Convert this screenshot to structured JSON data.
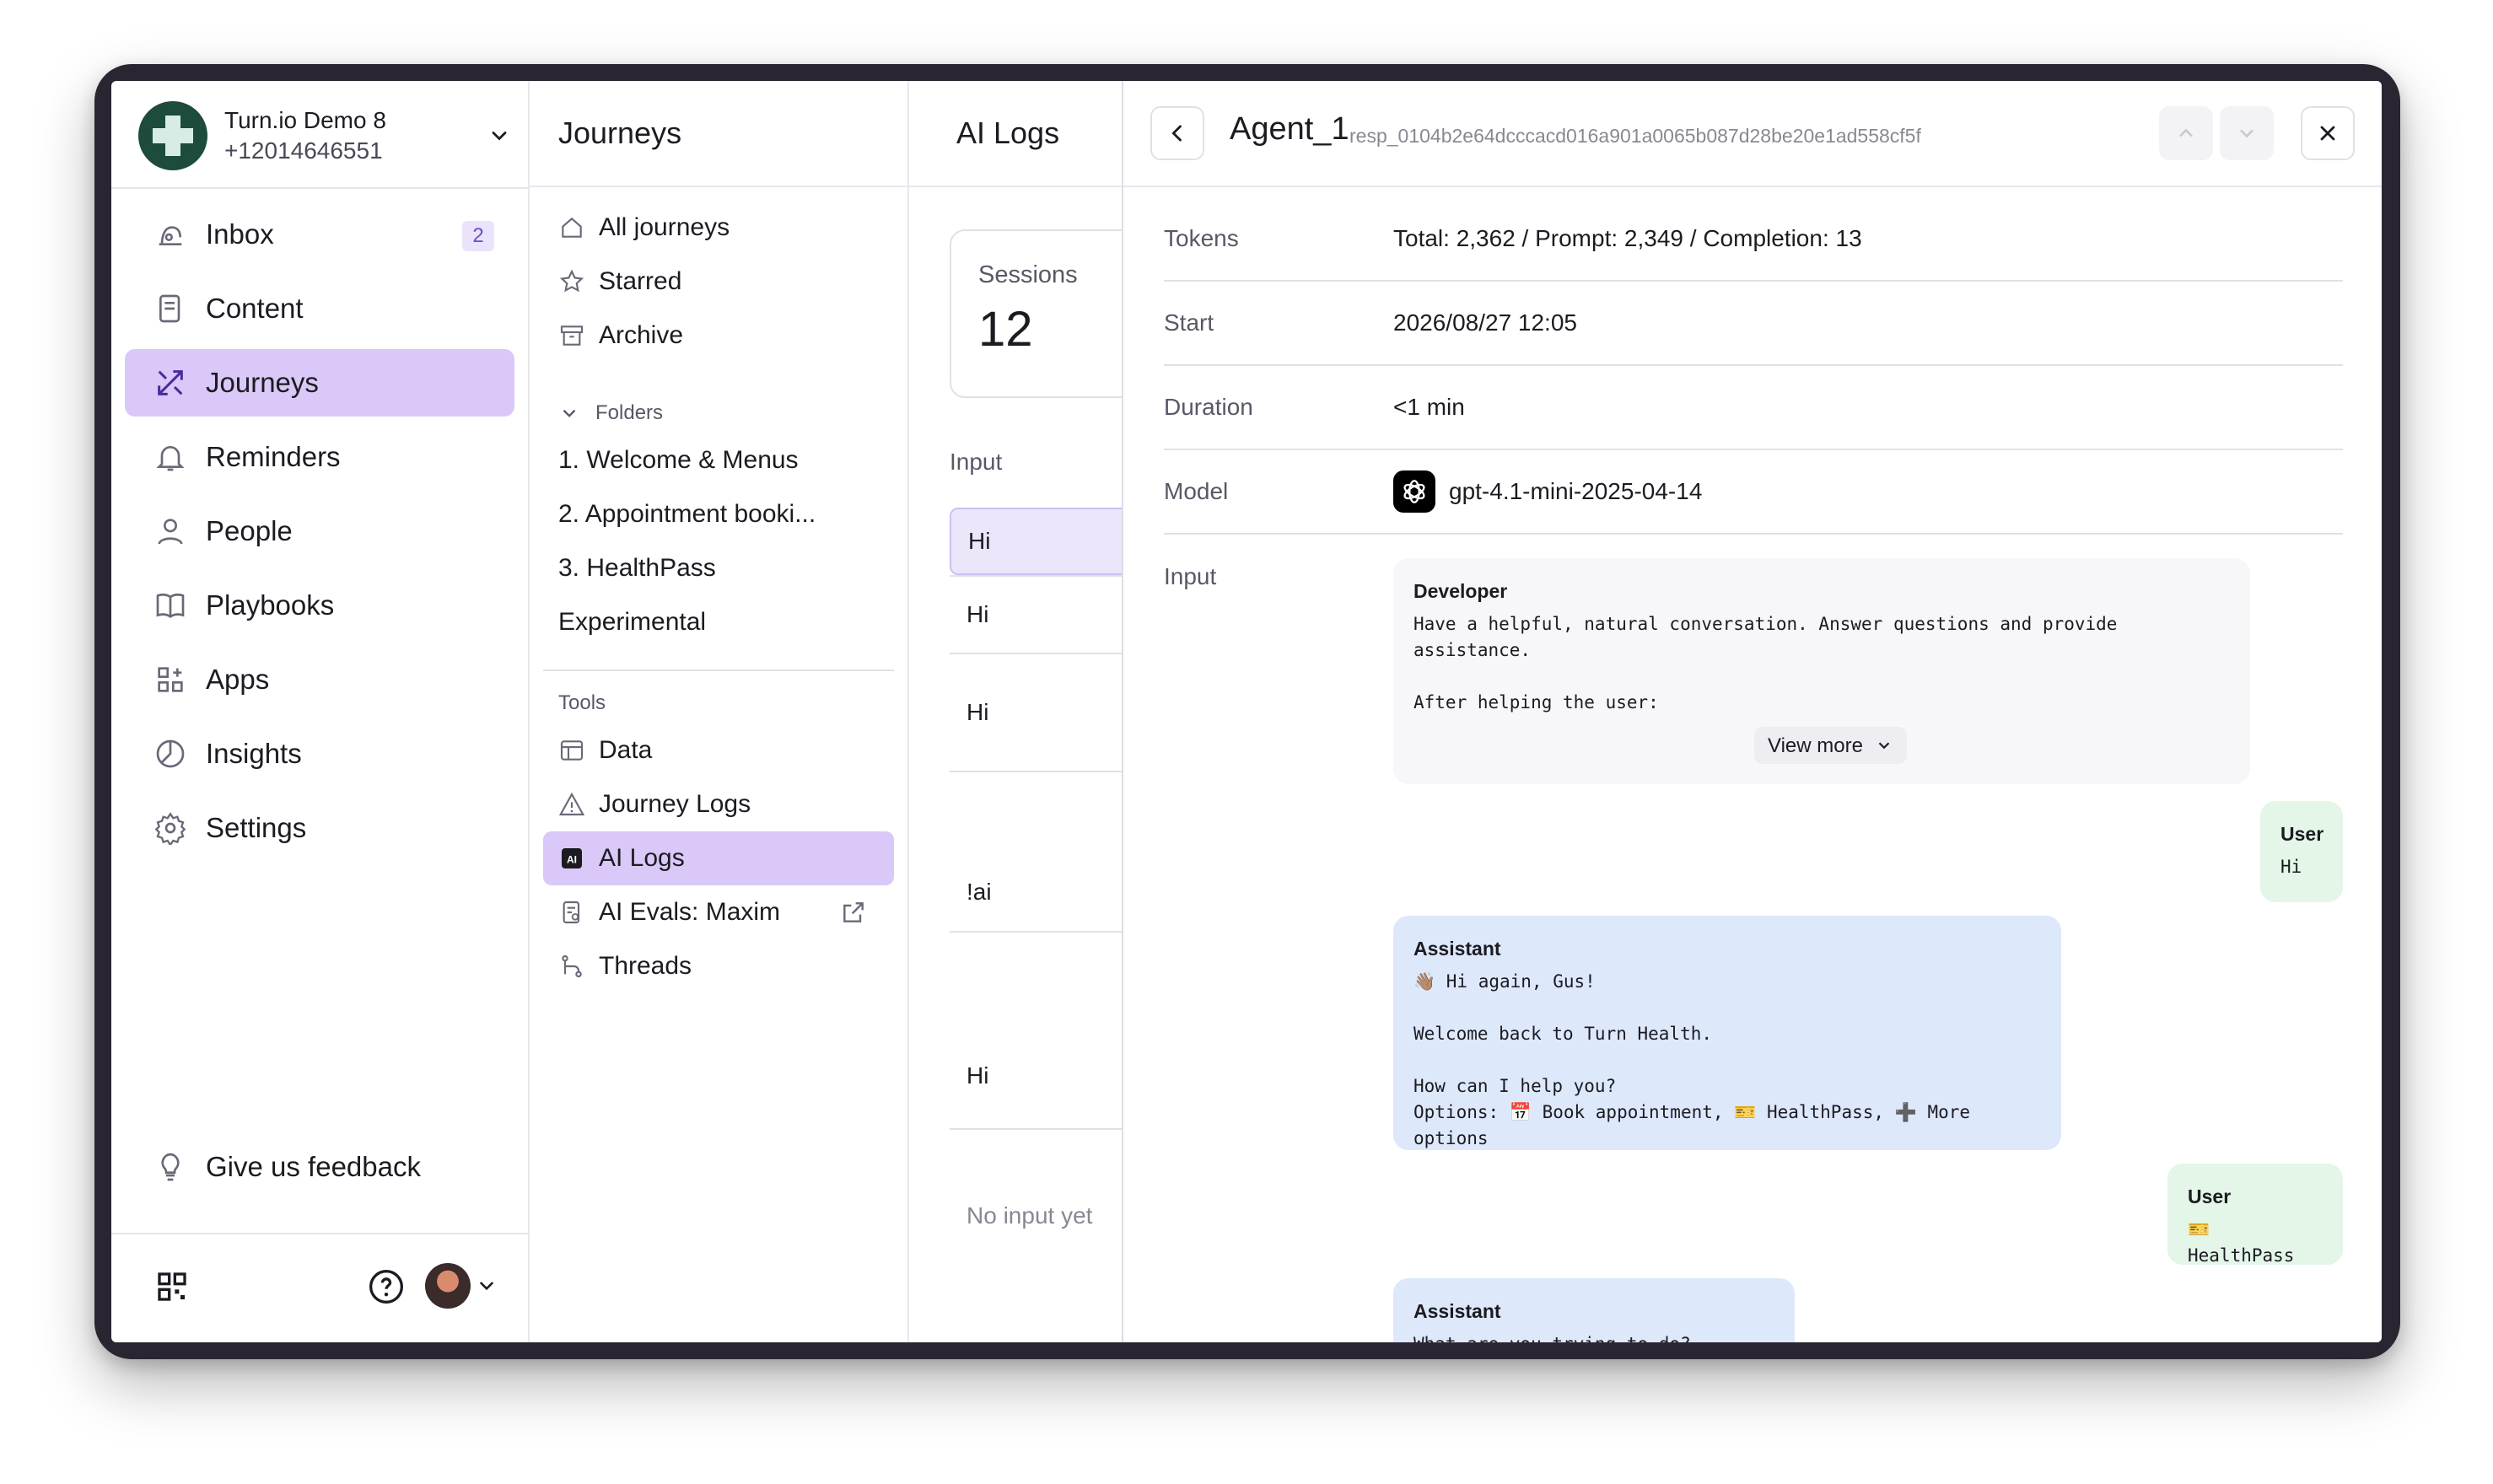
{
  "org": {
    "name": "Turn.io Demo 8",
    "phone": "+12014646551"
  },
  "sidebar": {
    "items": [
      {
        "label": "Inbox",
        "icon": "inbox-icon",
        "badge": "2"
      },
      {
        "label": "Content",
        "icon": "content-icon"
      },
      {
        "label": "Journeys",
        "icon": "journeys-icon",
        "active": true
      },
      {
        "label": "Reminders",
        "icon": "bell-icon"
      },
      {
        "label": "People",
        "icon": "person-icon"
      },
      {
        "label": "Playbooks",
        "icon": "book-icon"
      },
      {
        "label": "Apps",
        "icon": "apps-icon"
      },
      {
        "label": "Insights",
        "icon": "insights-icon"
      },
      {
        "label": "Settings",
        "icon": "gear-icon"
      }
    ],
    "feedback": "Give us feedback"
  },
  "journeys": {
    "title": "Journeys",
    "items": [
      {
        "label": "All journeys"
      },
      {
        "label": "Starred"
      },
      {
        "label": "Archive"
      }
    ],
    "folders_label": "Folders",
    "folders": [
      "1. Welcome & Menus",
      "2. Appointment booki...",
      "3. HealthPass",
      "Experimental"
    ],
    "tools_label": "Tools",
    "tools": [
      "Data",
      "Journey Logs",
      "AI Logs",
      "AI Evals: Maxim",
      "Threads"
    ]
  },
  "ailogs": {
    "title": "AI Logs",
    "sessions_label": "Sessions",
    "sessions_value": "12",
    "input_label": "Input",
    "rows": [
      "Hi",
      "Hi",
      "Hi",
      "!ai",
      "Hi"
    ],
    "no_input": "No input yet"
  },
  "detail": {
    "agent": "Agent_1",
    "resp_id": "resp_0104b2e64dcccacd016a901a0065b087d28be20e1ad558cf5f",
    "tokens_label": "Tokens",
    "tokens": "Total: 2,362 / Prompt: 2,349 / Completion: 13",
    "start_label": "Start",
    "start": "2026/08/27 12:05",
    "duration_label": "Duration",
    "duration": "<1 min",
    "model_label": "Model",
    "model": "gpt-4.1-mini-2025-04-14",
    "input_label": "Input",
    "messages": {
      "developer_role": "Developer",
      "developer_text": "Have a helpful, natural conversation. Answer questions and provide\nassistance.\n\nAfter helping the user:",
      "view_more": "View more",
      "user1_role": "User",
      "user1_text": "Hi",
      "assistant1_role": "Assistant",
      "assistant1_text": "👋🏽 Hi again, Gus!\n\nWelcome back to Turn Health.\n\nHow can I help you?\nOptions: 📅 Book appointment, 🎫 HealthPass, ➕ More options",
      "user2_role": "User",
      "user2_text": "🎫 HealthPass",
      "assistant2_role": "Assistant",
      "assistant2_text": "What are you trying to do?"
    }
  },
  "colors": {
    "accent": "#d9c8f8",
    "user_bubble": "#e3f6e8",
    "assistant_bubble": "#dde8fb"
  }
}
